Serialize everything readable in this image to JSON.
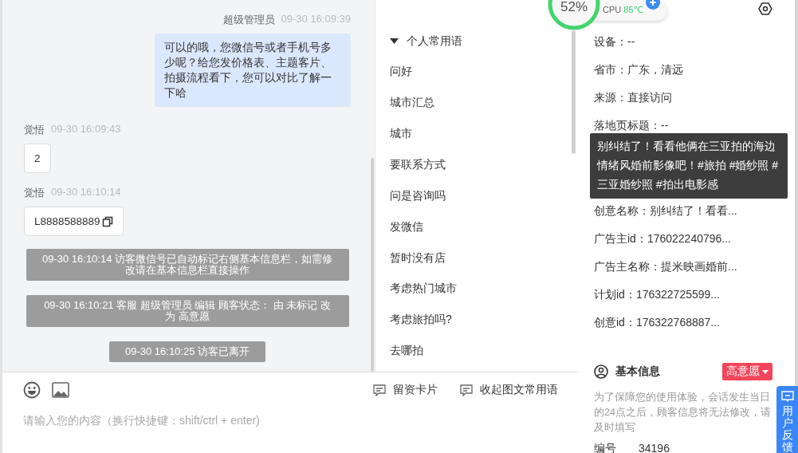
{
  "cpu_widget": {
    "percent": "52%",
    "label": "CPU",
    "temperature": "85℃"
  },
  "chat": {
    "messages": [
      {
        "kind": "agent",
        "sender": "超级管理员",
        "time": "09-30 16:09:39",
        "text": "可以的哦，您微信号或者手机号多少呢？给您发价格表、主题客片、拍摄流程看下，您可以对比了解一下哈"
      },
      {
        "kind": "visitor",
        "sender": "觉悟",
        "time": "09-30 16:09:43",
        "text": "2",
        "copyable": false
      },
      {
        "kind": "visitor",
        "sender": "觉悟",
        "time": "09-30 16:10:14",
        "text": "L8888588889",
        "copyable": true
      },
      {
        "kind": "system",
        "text": "09-30 16:10:14 访客微信号已自动标记右侧基本信息栏，如需修改请在基本信息栏直接操作"
      },
      {
        "kind": "system",
        "text": "09-30 16:10:21 客服 超级管理员 编辑 顾客状态： 由 未标记 改为 高意愿"
      },
      {
        "kind": "system",
        "text": "09-30 16:10:25 访客已离开"
      }
    ]
  },
  "phrases": {
    "group": {
      "title": "个人常用语",
      "expanded": true
    },
    "items": [
      "问好",
      "城市汇总",
      "城市",
      "要联系方式",
      "问是咨询吗",
      "发微信",
      "暂时没有店",
      "考虑热门城市",
      "考虑旅拍吗?",
      "去哪拍"
    ]
  },
  "toolbar": {
    "actions": [
      "留资卡片",
      "收起图文常用语"
    ]
  },
  "input": {
    "placeholder": "请输入您的内容（换行快捷键：shift/ctrl + enter)"
  },
  "visitor_info": {
    "fields": [
      {
        "text": "设备：--"
      },
      {
        "text": "省市：广东，清远"
      },
      {
        "text": "来源：直接访问"
      },
      {
        "text": "落地页标题：--"
      }
    ],
    "tooltip": "别纠结了！看看他俩在三亚拍的海边情绪风婚前影像吧！#旅拍 #婚纱照 #三亚婚纱照 #拍出电影感",
    "fields_below": [
      {
        "text": "创意名称：别纠结了！看看..."
      },
      {
        "text": "广告主id：176022240796..."
      },
      {
        "text": "广告主名称：提米映画婚前..."
      },
      {
        "text": "计划id：176322725599..."
      },
      {
        "text": "创意id：176322768887..."
      }
    ]
  },
  "basic_info": {
    "title": "基本信息",
    "status": {
      "label": "高意愿",
      "color": "#f5455c"
    },
    "notice": "为了保障您的使用体验，会话发生当日的24点之后，顾客信息将无法修改，请及时填写",
    "fields": [
      {
        "label": "编号",
        "value": "34196"
      }
    ]
  },
  "feedback_button": "用户反馈"
}
